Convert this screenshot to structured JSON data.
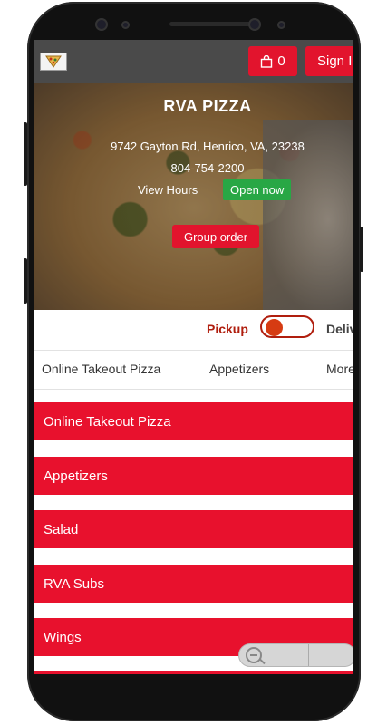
{
  "header": {
    "logo": "restaurant-logo",
    "cart_icon": "shopping-bag-icon",
    "cart_count": "0",
    "signin_label": "Sign In"
  },
  "hero": {
    "restaurant_name": "RVA PIZZA",
    "address": "9742 Gayton Rd, Henrico, VA, 23238",
    "phone": "804-754-2200",
    "view_hours": "View Hours",
    "open_status": "Open now",
    "group_order": "Group order"
  },
  "order_mode": {
    "pickup_label": "Pickup",
    "delivery_label": "Delivery",
    "selected": "Pickup"
  },
  "tabs": [
    {
      "label": "Online Takeout Pizza"
    },
    {
      "label": "Appetizers"
    },
    {
      "label": "More"
    }
  ],
  "categories": [
    {
      "label": "Online Takeout Pizza"
    },
    {
      "label": "Appetizers"
    },
    {
      "label": "Salad"
    },
    {
      "label": "RVA Subs"
    },
    {
      "label": "Wings"
    }
  ],
  "colors": {
    "accent": "#e8112d",
    "open_badge": "#28a745",
    "toggle": "#b01e0e"
  }
}
